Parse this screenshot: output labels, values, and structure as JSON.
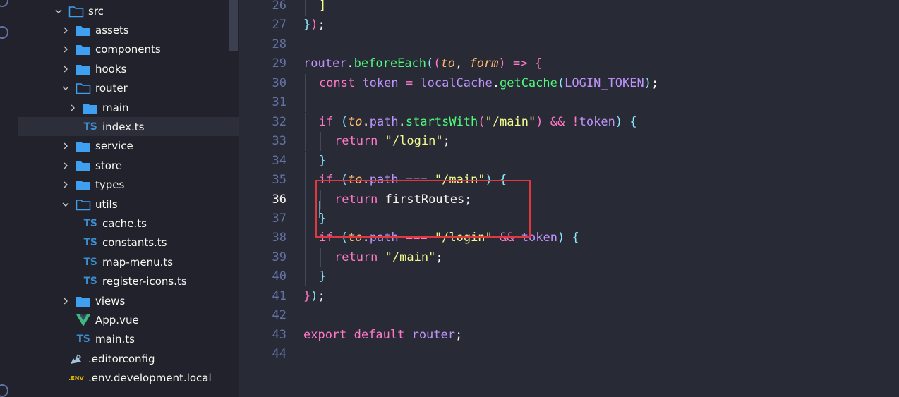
{
  "explorer": {
    "items": [
      {
        "label": "src",
        "kind": "folder-open",
        "depth": 1
      },
      {
        "label": "assets",
        "kind": "folder",
        "depth": 2
      },
      {
        "label": "components",
        "kind": "folder",
        "depth": 2
      },
      {
        "label": "hooks",
        "kind": "folder",
        "depth": 2
      },
      {
        "label": "router",
        "kind": "folder-open",
        "depth": 2
      },
      {
        "label": "main",
        "kind": "folder",
        "depth": 3
      },
      {
        "label": "index.ts",
        "kind": "ts",
        "depth": 3,
        "selected": true
      },
      {
        "label": "service",
        "kind": "folder",
        "depth": 2
      },
      {
        "label": "store",
        "kind": "folder",
        "depth": 2
      },
      {
        "label": "types",
        "kind": "folder",
        "depth": 2
      },
      {
        "label": "utils",
        "kind": "folder-open",
        "depth": 2
      },
      {
        "label": "cache.ts",
        "kind": "ts",
        "depth": 3
      },
      {
        "label": "constants.ts",
        "kind": "ts",
        "depth": 3
      },
      {
        "label": "map-menu.ts",
        "kind": "ts",
        "depth": 3
      },
      {
        "label": "register-icons.ts",
        "kind": "ts",
        "depth": 3
      },
      {
        "label": "views",
        "kind": "folder",
        "depth": 2
      },
      {
        "label": "App.vue",
        "kind": "vue",
        "depth": 2
      },
      {
        "label": "main.ts",
        "kind": "ts",
        "depth": 2
      },
      {
        "label": ".editorconfig",
        "kind": "editorconfig",
        "depth": 1
      },
      {
        "label": ".env.development.local",
        "kind": "env",
        "depth": 1
      }
    ],
    "ts_badge": "TS",
    "env_badge": ".ENV"
  },
  "editor": {
    "active_line": 36,
    "lines": [
      {
        "n": "26",
        "tokens": [
          [
            "b1",
            "]"
          ]
        ],
        "indent": 1
      },
      {
        "n": "27",
        "tokens": [
          [
            "b3",
            "}"
          ],
          [
            "b2",
            ")"
          ],
          [
            "v",
            ";"
          ]
        ],
        "indent": 0
      },
      {
        "n": "28",
        "tokens": [],
        "indent": 0
      },
      {
        "n": "29",
        "tokens": [
          [
            "p",
            "router"
          ],
          [
            "v",
            "."
          ],
          [
            "f",
            "beforeEach"
          ],
          [
            "b3",
            "("
          ],
          [
            "b2",
            "("
          ],
          [
            "pi",
            "to"
          ],
          [
            "v",
            ", "
          ],
          [
            "pi",
            "form"
          ],
          [
            "b2",
            ")"
          ],
          [
            "v",
            " "
          ],
          [
            "k",
            "=>"
          ],
          [
            "v",
            " "
          ],
          [
            "b2",
            "{"
          ]
        ],
        "indent": 0
      },
      {
        "n": "30",
        "tokens": [
          [
            "k",
            "const"
          ],
          [
            "v",
            " "
          ],
          [
            "p",
            "token"
          ],
          [
            "v",
            " "
          ],
          [
            "k",
            "="
          ],
          [
            "v",
            " "
          ],
          [
            "p",
            "localCache"
          ],
          [
            "v",
            "."
          ],
          [
            "f",
            "getCache"
          ],
          [
            "b3",
            "("
          ],
          [
            "p",
            "LOGIN_TOKEN"
          ],
          [
            "b3",
            ")"
          ],
          [
            "v",
            ";"
          ]
        ],
        "indent": 1
      },
      {
        "n": "31",
        "tokens": [],
        "indent": 1
      },
      {
        "n": "32",
        "tokens": [
          [
            "k",
            "if"
          ],
          [
            "v",
            " "
          ],
          [
            "b3",
            "("
          ],
          [
            "pi",
            "to"
          ],
          [
            "v",
            "."
          ],
          [
            "p",
            "path"
          ],
          [
            "v",
            "."
          ],
          [
            "f",
            "startsWith"
          ],
          [
            "b2",
            "("
          ],
          [
            "s",
            "\"/main\""
          ],
          [
            "b2",
            ")"
          ],
          [
            "v",
            " "
          ],
          [
            "k",
            "&&"
          ],
          [
            "v",
            " "
          ],
          [
            "k",
            "!"
          ],
          [
            "p",
            "token"
          ],
          [
            "b3",
            ")"
          ],
          [
            "v",
            " "
          ],
          [
            "b3",
            "{"
          ]
        ],
        "indent": 1
      },
      {
        "n": "33",
        "tokens": [
          [
            "k",
            "return"
          ],
          [
            "v",
            " "
          ],
          [
            "s",
            "\"/login\""
          ],
          [
            "v",
            ";"
          ]
        ],
        "indent": 2
      },
      {
        "n": "34",
        "tokens": [
          [
            "b3",
            "}"
          ]
        ],
        "indent": 1
      },
      {
        "n": "35",
        "tokens": [
          [
            "k",
            "if"
          ],
          [
            "v",
            " "
          ],
          [
            "b3",
            "("
          ],
          [
            "pi",
            "to"
          ],
          [
            "v",
            "."
          ],
          [
            "p",
            "path"
          ],
          [
            "v",
            " "
          ],
          [
            "k",
            "==="
          ],
          [
            "v",
            " "
          ],
          [
            "s",
            "\"/main\""
          ],
          [
            "b3",
            ")"
          ],
          [
            "v",
            " "
          ],
          [
            "b3",
            "{"
          ]
        ],
        "indent": 1
      },
      {
        "n": "36",
        "tokens": [
          [
            "k",
            "return"
          ],
          [
            "v",
            " firstRoutes;"
          ]
        ],
        "indent": 2
      },
      {
        "n": "37",
        "tokens": [
          [
            "b3",
            "}"
          ]
        ],
        "indent": 1
      },
      {
        "n": "38",
        "tokens": [
          [
            "k",
            "if"
          ],
          [
            "v",
            " "
          ],
          [
            "b3",
            "("
          ],
          [
            "pi",
            "to"
          ],
          [
            "v",
            "."
          ],
          [
            "p",
            "path"
          ],
          [
            "v",
            " "
          ],
          [
            "k",
            "==="
          ],
          [
            "v",
            " "
          ],
          [
            "s",
            "\"/login\""
          ],
          [
            "v",
            " "
          ],
          [
            "k",
            "&&"
          ],
          [
            "v",
            " "
          ],
          [
            "p",
            "token"
          ],
          [
            "b3",
            ")"
          ],
          [
            "v",
            " "
          ],
          [
            "b3",
            "{"
          ]
        ],
        "indent": 1
      },
      {
        "n": "39",
        "tokens": [
          [
            "k",
            "return"
          ],
          [
            "v",
            " "
          ],
          [
            "s",
            "\"/main\""
          ],
          [
            "v",
            ";"
          ]
        ],
        "indent": 2
      },
      {
        "n": "40",
        "tokens": [
          [
            "b3",
            "}"
          ]
        ],
        "indent": 1
      },
      {
        "n": "41",
        "tokens": [
          [
            "b2",
            "}"
          ],
          [
            "b3",
            ")"
          ],
          [
            "v",
            ";"
          ]
        ],
        "indent": 0
      },
      {
        "n": "42",
        "tokens": [],
        "indent": 0
      },
      {
        "n": "43",
        "tokens": [
          [
            "k",
            "export"
          ],
          [
            "v",
            " "
          ],
          [
            "k",
            "default"
          ],
          [
            "v",
            " "
          ],
          [
            "p",
            "router"
          ],
          [
            "v",
            ";"
          ]
        ],
        "indent": 0
      },
      {
        "n": "44",
        "tokens": [],
        "indent": 0
      }
    ]
  },
  "colors": {
    "background": "#282a36",
    "sidebar": "#21222c",
    "highlight_box": "#e0383e",
    "folder": "#3f9ff0",
    "ts": "#3b8fd1",
    "vue": "#41b883"
  }
}
